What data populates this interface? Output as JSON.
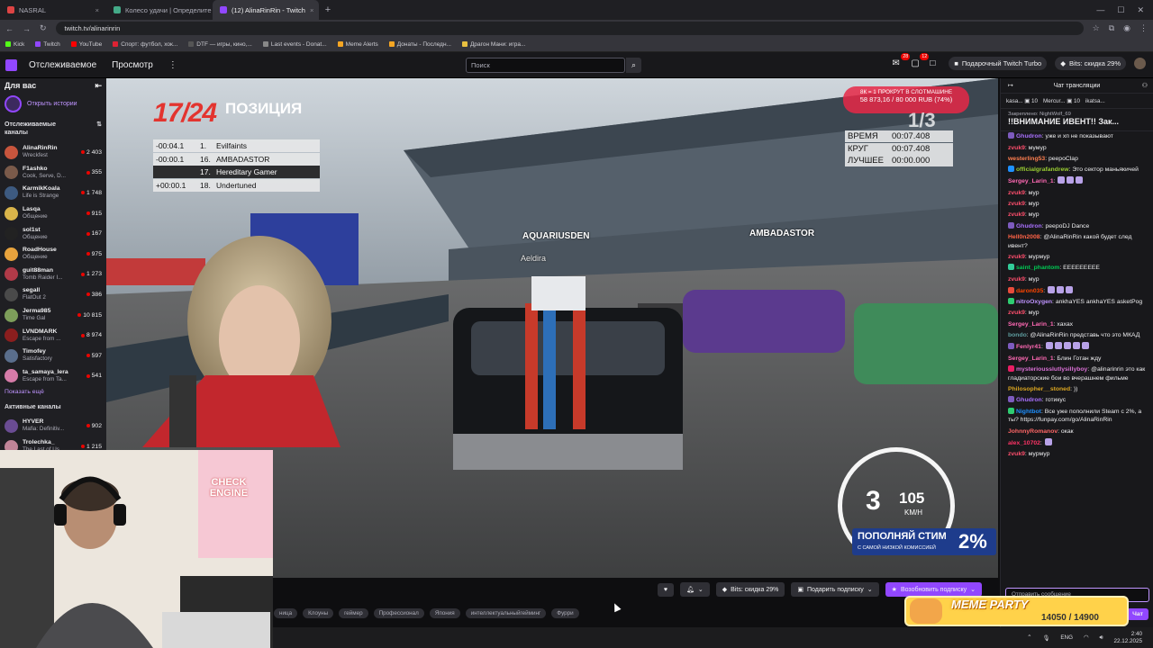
{
  "browser": {
    "tabs": [
      {
        "title": "NASRAL",
        "color": "#d44",
        "active": false
      },
      {
        "title": "Колесо удачи | Определите п...",
        "color": "#4a8",
        "active": false
      },
      {
        "title": "(12) AlinaRinRin - Twitch",
        "color": "#9147ff",
        "active": true
      }
    ],
    "new_tab": "+",
    "url": "twitch.tv/alinarinrin",
    "bookmarks": [
      {
        "label": "Kick",
        "color": "#53fc18"
      },
      {
        "label": "Twitch",
        "color": "#9147ff"
      },
      {
        "label": "YouTube",
        "color": "#f00"
      },
      {
        "label": "Спорт: футбол, хок...",
        "color": "#d23"
      },
      {
        "label": "DTF — игры, кино,...",
        "color": "#555"
      },
      {
        "label": "Last events - Donat...",
        "color": "#888"
      },
      {
        "label": "Meme Alerts",
        "color": "#f5a623"
      },
      {
        "label": "Донаты - Последн...",
        "color": "#f5a623"
      },
      {
        "label": "Драгон Мани: игра...",
        "color": "#e8c040"
      }
    ]
  },
  "twitch_nav": {
    "following": "Отслеживаемое",
    "browse": "Просмотр",
    "more": "⋮",
    "search_placeholder": "Поиск",
    "notif_count": "28",
    "inbox_count": "12",
    "turbo": "Подарочный Twitch Turbo",
    "bits": "Bits: скидка 29%"
  },
  "sidebar": {
    "title": "Для вас",
    "history": "Открыть истории",
    "followed_title": "Отслеживаемые каналы",
    "channels": [
      {
        "name": "AlinaRinRin",
        "game": "Wreckfest",
        "viewers": "2 403",
        "color": "#c8553d"
      },
      {
        "name": "F1ashko",
        "game": "Cook, Serve, D...",
        "viewers": "355",
        "color": "#7a5a4a"
      },
      {
        "name": "KarmikKoala",
        "game": "Life is Strange",
        "viewers": "1 748",
        "color": "#3d5a80"
      },
      {
        "name": "Lasqa",
        "game": "Общение",
        "viewers": "915",
        "color": "#d9b44a"
      },
      {
        "name": "sol1st",
        "game": "Общение",
        "viewers": "167",
        "color": "#222"
      },
      {
        "name": "RoadHouse",
        "game": "Общение",
        "viewers": "975",
        "color": "#e8a33d"
      },
      {
        "name": "guit88man",
        "game": "Tomb Raider I...",
        "viewers": "1 273",
        "color": "#b03a48"
      },
      {
        "name": "segall",
        "game": "FlatOut 2",
        "viewers": "386",
        "color": "#4a4a4a"
      },
      {
        "name": "Jerma985",
        "game": "Time Gal",
        "viewers": "10 815",
        "color": "#7d9e5a"
      },
      {
        "name": "LVNDMARK",
        "game": "Escape from ...",
        "viewers": "8 974",
        "color": "#8b1e1e"
      },
      {
        "name": "Timofey",
        "game": "Satisfactory",
        "viewers": "597",
        "color": "#5a6e8c"
      },
      {
        "name": "ta_samaya_lera",
        "game": "Escape from Ta...",
        "viewers": "541",
        "color": "#d67ba8"
      }
    ],
    "show_more": "Показать ещё",
    "active_title": "Активные каналы",
    "active_channels": [
      {
        "name": "HYVER",
        "game": "Mafia: Definitiv...",
        "viewers": "902",
        "color": "#6a4c93"
      },
      {
        "name": "Trolechka_",
        "game": "The Last of Us",
        "viewers": "1 215",
        "color": "#c08497"
      }
    ]
  },
  "game_hud": {
    "position": "17/24",
    "position_label": "ПОЗИЦИЯ",
    "standings": [
      {
        "gap": "-00:04.1",
        "pos": "1.",
        "name": "Evilfaints"
      },
      {
        "gap": "-00:00.1",
        "pos": "16.",
        "name": "AMBADASTOR"
      },
      {
        "gap": "",
        "pos": "17.",
        "name": "Hereditary Gamer"
      },
      {
        "gap": "+00:00.1",
        "pos": "18.",
        "name": "Undertuned"
      }
    ],
    "lap_label": "КРУГ",
    "lap": "1/3",
    "times": [
      {
        "label": "ВРЕМЯ",
        "value": "00:07.408"
      },
      {
        "label": "КРУГ",
        "value": "00:07.408"
      },
      {
        "label": "ЛУЧШЕЕ",
        "value": "00:00.000"
      }
    ],
    "donation_line1": "8К = 1 ПРОКРУТ В СЛОТМАШИНЕ",
    "donation_line2": "58 873,16 / 80 000 RUB (74%)",
    "rival1": "AQUARIUSDEN",
    "rival1_sub": "Aeldira",
    "rival2": "AMBADASTOR",
    "gear": "3",
    "speed": "105",
    "speed_unit": "KM/H",
    "promo_title": "ПОПОЛНЯЙ СТИМ",
    "promo_sub": "С САМОЙ НИЗКОЙ КОМИССИЕЙ",
    "promo_pct": "2%"
  },
  "below_video": {
    "bits_btn": "Bits: скидка 29%",
    "gift_btn": "Подарить подписку",
    "resub_btn": "Возобновить подписку",
    "tags": [
      "ница",
      "Клоуны",
      "геймер",
      "Профессионал",
      "Япония",
      "интеллектуальныйгейминг",
      "Фурри"
    ]
  },
  "chat": {
    "title": "Чат трансляции",
    "gifts": [
      {
        "name": "kasa...",
        "count": "10"
      },
      {
        "name": "Mercur...",
        "count": "10"
      },
      {
        "name": "ikatsa...",
        "count": ""
      }
    ],
    "pinned_by": "Закреплено: NightWolf_69",
    "pinned_text": "!!ВНИМАНИЕ ИВЕНТ!! Зак...",
    "messages": [
      {
        "user": "Ghudron",
        "color": "#a970ff",
        "text": "уже и хп не показывают",
        "badge": "#7d5bbe"
      },
      {
        "user": "zvuk9",
        "color": "#ff4f6d",
        "text": "мумур",
        "badge": ""
      },
      {
        "user": "westerling53",
        "color": "#ff7f50",
        "text": "peepoClap",
        "badge": ""
      },
      {
        "user": "officialgrafandrew",
        "color": "#9acd32",
        "text": "Это сектор маньякичей",
        "badge": "#1e90ff"
      },
      {
        "user": "Sergey_Larin_1",
        "color": "#ff69b4",
        "text": "",
        "badge": "",
        "emotes": 3
      },
      {
        "user": "zvuk9",
        "color": "#ff4f6d",
        "text": "мур",
        "badge": ""
      },
      {
        "user": "zvuk9",
        "color": "#ff4f6d",
        "text": "мур",
        "badge": ""
      },
      {
        "user": "zvuk9",
        "color": "#ff4f6d",
        "text": "мур",
        "badge": ""
      },
      {
        "user": "Ghudron",
        "color": "#a970ff",
        "text": "peepoDJ Dance",
        "badge": "#7d5bbe"
      },
      {
        "user": "Hell0n2008",
        "color": "#ff6347",
        "text": "@AlinaRinRin какой будет след ивент?",
        "badge": ""
      },
      {
        "user": "zvuk9",
        "color": "#ff4f6d",
        "text": "мурмур",
        "badge": ""
      },
      {
        "user": "saint_phantom",
        "color": "#00c853",
        "text": "ЕЕЕЕЕЕЕЕЕ",
        "badge": "#3c9"
      },
      {
        "user": "zvuk9",
        "color": "#ff4f6d",
        "text": "мур",
        "badge": ""
      },
      {
        "user": "daron035",
        "color": "#ff4500",
        "text": "",
        "badge": "#e74c3c",
        "emotes": 3
      },
      {
        "user": "nitroOxygen",
        "color": "#bf94ff",
        "text": "ankhaYES ankhaYES asketPog",
        "badge": "#2ecc71"
      },
      {
        "user": "zvuk9",
        "color": "#ff4f6d",
        "text": "мур",
        "badge": ""
      },
      {
        "user": "Sergey_Larin_1",
        "color": "#ff69b4",
        "text": "хахах",
        "badge": ""
      },
      {
        "user": "bondo",
        "color": "#5f9ea0",
        "text": "@AlinaRinRin представь что это МКАД",
        "badge": ""
      },
      {
        "user": "Fenlyr41",
        "color": "#ff69b4",
        "text": "",
        "badge": "#7d5bbe",
        "emotes": 5
      },
      {
        "user": "Sergey_Larin_1",
        "color": "#ff69b4",
        "text": "Блин Готан жду",
        "badge": ""
      },
      {
        "user": "mysteriousslutlysillyboy",
        "color": "#da70d6",
        "text": "@alinarinrin это как гладиаторские бои во вчерашнем фильме",
        "badge": "#e91e63"
      },
      {
        "user": "Philosopher__stoned",
        "color": "#daa520",
        "text": "))",
        "badge": ""
      },
      {
        "user": "Ghudron",
        "color": "#a970ff",
        "text": "готикус",
        "badge": "#7d5bbe"
      },
      {
        "user": "Nightbot",
        "color": "#1e90ff",
        "text": "Все уже пополнили Steam с 2%, а ты? https://funpay.com/go/AlinaRinRin",
        "badge": "#2ecc71"
      },
      {
        "user": "JohnnyRomanov",
        "color": "#ff6666",
        "text": "окак",
        "badge": ""
      },
      {
        "user": "alex_10702",
        "color": "#ff3366",
        "text": "",
        "badge": "",
        "emotes": 1
      },
      {
        "user": "zvuk9",
        "color": "#ff4f6d",
        "text": "мурмур",
        "badge": ""
      }
    ],
    "input_placeholder": "Отправить сообщение",
    "send": "Чат"
  },
  "overlays": {
    "meme_party": "MEME PARTY",
    "meme_count": "14050 / 14900",
    "webcam_sign": "CHECK ENGINE"
  },
  "taskbar": {
    "lang": "ENG",
    "time": "2:40",
    "date": "22.12.2025"
  }
}
